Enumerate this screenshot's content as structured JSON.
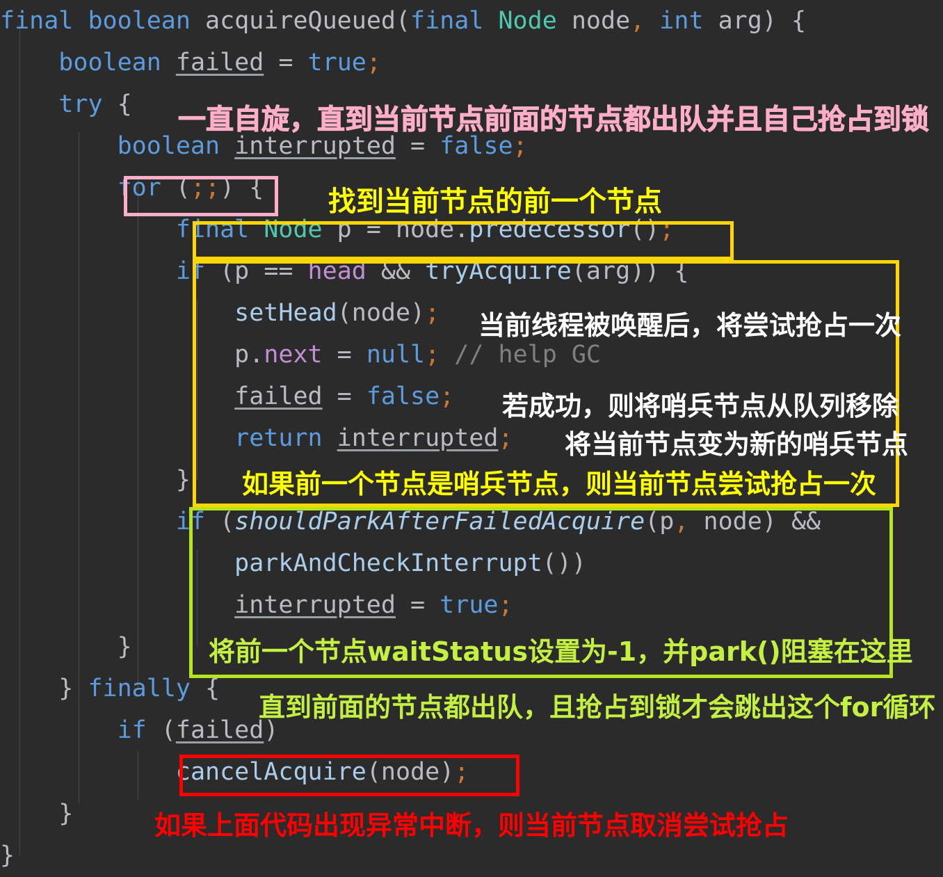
{
  "editor": {
    "theme": "dark",
    "background": "#2b2b2b",
    "language": "java",
    "method_name": "acquireQueued"
  },
  "colors": {
    "background": "#2b2b2b",
    "keyword": "#5c9cde",
    "type": "#4ec9b0",
    "plain": "#b9bcc2",
    "field": "#c08fd4",
    "function": "#a9cdeb",
    "semicolon": "#cc7832",
    "comment": "#808080",
    "box_pink": "#ffaec9",
    "box_yellow": "#ffd700",
    "box_green": "#b5e61d",
    "box_red": "#ff0000",
    "anno_yellow": "#ffff00",
    "anno_white": "#ffffff",
    "anno_green": "#c3f041",
    "anno_red": "#ff0000",
    "anno_pink": "#ffaec9"
  },
  "code_lines": [
    {
      "id": "line-signature",
      "indent": 0,
      "tokens": [
        {
          "t": "final",
          "c": "kw"
        },
        {
          "t": " ",
          "c": "pln"
        },
        {
          "t": "boolean",
          "c": "kw"
        },
        {
          "t": " ",
          "c": "pln"
        },
        {
          "t": "acquireQueued",
          "c": "pln"
        },
        {
          "t": "(",
          "c": "pln"
        },
        {
          "t": "final",
          "c": "kw"
        },
        {
          "t": " ",
          "c": "pln"
        },
        {
          "t": "Node",
          "c": "typ"
        },
        {
          "t": " node",
          "c": "pln"
        },
        {
          "t": ",",
          "c": "semi"
        },
        {
          "t": " ",
          "c": "pln"
        },
        {
          "t": "int",
          "c": "kw"
        },
        {
          "t": " arg",
          "c": "pln"
        },
        {
          "t": ") {",
          "c": "pln"
        }
      ]
    },
    {
      "id": "line-failed-true",
      "indent": 1,
      "tokens": [
        {
          "t": "boolean",
          "c": "kw"
        },
        {
          "t": " ",
          "c": "pln"
        },
        {
          "t": "failed",
          "c": "var-u"
        },
        {
          "t": " = ",
          "c": "pln"
        },
        {
          "t": "true",
          "c": "kw"
        },
        {
          "t": ";",
          "c": "semi"
        }
      ]
    },
    {
      "id": "line-try",
      "indent": 1,
      "tokens": [
        {
          "t": "try",
          "c": "kw"
        },
        {
          "t": " {",
          "c": "pln"
        }
      ]
    },
    {
      "id": "line-interrupted-false",
      "indent": 2,
      "tokens": [
        {
          "t": "boolean",
          "c": "kw"
        },
        {
          "t": " ",
          "c": "pln"
        },
        {
          "t": "interrupted",
          "c": "var-u"
        },
        {
          "t": " = ",
          "c": "pln"
        },
        {
          "t": "false",
          "c": "kw"
        },
        {
          "t": ";",
          "c": "semi"
        }
      ]
    },
    {
      "id": "line-for",
      "indent": 2,
      "tokens": [
        {
          "t": "for",
          "c": "kw"
        },
        {
          "t": " (",
          "c": "pln"
        },
        {
          "t": ";",
          "c": "semi"
        },
        {
          "t": ";",
          "c": "semi"
        },
        {
          "t": ") {",
          "c": "pln"
        }
      ]
    },
    {
      "id": "line-predecessor",
      "indent": 3,
      "tokens": [
        {
          "t": "final",
          "c": "kw"
        },
        {
          "t": " ",
          "c": "pln"
        },
        {
          "t": "Node",
          "c": "typ"
        },
        {
          "t": " p = node.",
          "c": "pln"
        },
        {
          "t": "predecessor",
          "c": "fn"
        },
        {
          "t": "()",
          "c": "pln"
        },
        {
          "t": ";",
          "c": "semi"
        }
      ]
    },
    {
      "id": "line-if-head",
      "indent": 3,
      "tokens": [
        {
          "t": "if",
          "c": "kw"
        },
        {
          "t": " (p == ",
          "c": "pln"
        },
        {
          "t": "head",
          "c": "fld"
        },
        {
          "t": " && ",
          "c": "pln"
        },
        {
          "t": "tryAcquire",
          "c": "fn"
        },
        {
          "t": "(arg)) {",
          "c": "pln"
        }
      ]
    },
    {
      "id": "line-sethead",
      "indent": 4,
      "tokens": [
        {
          "t": "setHead",
          "c": "fn"
        },
        {
          "t": "(node)",
          "c": "pln"
        },
        {
          "t": ";",
          "c": "semi"
        }
      ]
    },
    {
      "id": "line-pnext-null",
      "indent": 4,
      "tokens": [
        {
          "t": "p.",
          "c": "pln"
        },
        {
          "t": "next",
          "c": "fld"
        },
        {
          "t": " = ",
          "c": "pln"
        },
        {
          "t": "null",
          "c": "kw"
        },
        {
          "t": ";",
          "c": "semi"
        },
        {
          "t": " ",
          "c": "pln"
        },
        {
          "t": "// help GC",
          "c": "cmt"
        }
      ]
    },
    {
      "id": "line-failed-false",
      "indent": 4,
      "tokens": [
        {
          "t": "failed",
          "c": "var-u"
        },
        {
          "t": " = ",
          "c": "pln"
        },
        {
          "t": "false",
          "c": "kw"
        },
        {
          "t": ";",
          "c": "semi"
        }
      ]
    },
    {
      "id": "line-return-interrupted",
      "indent": 4,
      "tokens": [
        {
          "t": "return",
          "c": "kw"
        },
        {
          "t": " ",
          "c": "pln"
        },
        {
          "t": "interrupted",
          "c": "var-u"
        },
        {
          "t": ";",
          "c": "semi"
        }
      ]
    },
    {
      "id": "line-close-if-head",
      "indent": 3,
      "tokens": [
        {
          "t": "}",
          "c": "pln"
        }
      ]
    },
    {
      "id": "line-if-shouldpark",
      "indent": 3,
      "tokens": [
        {
          "t": "if",
          "c": "kw"
        },
        {
          "t": " (",
          "c": "pln"
        },
        {
          "t": "shouldParkAfterFailedAcquire",
          "c": "ital"
        },
        {
          "t": "(p",
          "c": "pln"
        },
        {
          "t": ",",
          "c": "semi"
        },
        {
          "t": " node) &&",
          "c": "pln"
        }
      ]
    },
    {
      "id": "line-parkcheck",
      "indent": 4,
      "tokens": [
        {
          "t": "parkAndCheckInterrupt",
          "c": "fn"
        },
        {
          "t": "())",
          "c": "pln"
        }
      ]
    },
    {
      "id": "line-interrupted-true",
      "indent": 4,
      "tokens": [
        {
          "t": "interrupted",
          "c": "var-u"
        },
        {
          "t": " = ",
          "c": "pln"
        },
        {
          "t": "true",
          "c": "kw"
        },
        {
          "t": ";",
          "c": "semi"
        }
      ]
    },
    {
      "id": "line-close-for",
      "indent": 2,
      "tokens": [
        {
          "t": "}",
          "c": "pln"
        }
      ]
    },
    {
      "id": "line-finally",
      "indent": 1,
      "tokens": [
        {
          "t": "}",
          "c": "pln"
        },
        {
          "t": " ",
          "c": "pln"
        },
        {
          "t": "finally",
          "c": "kw"
        },
        {
          "t": " {",
          "c": "pln"
        }
      ]
    },
    {
      "id": "line-if-failed",
      "indent": 2,
      "tokens": [
        {
          "t": "if",
          "c": "kw"
        },
        {
          "t": " (",
          "c": "pln"
        },
        {
          "t": "failed",
          "c": "var-u"
        },
        {
          "t": ")",
          "c": "pln"
        }
      ]
    },
    {
      "id": "line-cancelacquire",
      "indent": 3,
      "tokens": [
        {
          "t": "cancelAcquire",
          "c": "fn"
        },
        {
          "t": "(node)",
          "c": "pln"
        },
        {
          "t": ";",
          "c": "semi"
        }
      ]
    },
    {
      "id": "line-close-finally",
      "indent": 1,
      "tokens": [
        {
          "t": "}",
          "c": "pln"
        }
      ]
    },
    {
      "id": "line-close-method",
      "indent": 0,
      "tokens": [
        {
          "t": "}",
          "c": "pln"
        }
      ]
    }
  ],
  "annotations": {
    "spin_note": "一直自旋，直到当前节点前面的节点都出队并且自己抢占到锁",
    "find_predecessor": "找到当前节点的前一个节点",
    "thread_awake_try": "当前线程被唤醒后，将尝试抢占一次",
    "success_remove_head": "若成功，则将哨兵节点从队列移除",
    "become_new_head": "将当前节点变为新的哨兵节点",
    "prev_is_head_try": "如果前一个节点是哨兵节点，则当前节点尝试抢占一次",
    "set_waitstatus_park": "将前一个节点waitStatus设置为-1，并park()阻塞在这里",
    "break_for_loop": "直到前面的节点都出队，且抢占到锁才会跳出这个for循环",
    "exception_cancel": "如果上面代码出现异常中断，则当前节点取消尝试抢占"
  },
  "highlight_boxes": [
    {
      "name": "for-loop-box",
      "color": "#ffaec9",
      "target": "for (;;)"
    },
    {
      "name": "predecessor-box",
      "color": "#ffd700",
      "target": "final Node p = node.predecessor();"
    },
    {
      "name": "try-acquire-box",
      "color": "#ffd700",
      "target": "if (p == head && tryAcquire(arg)) { ... }"
    },
    {
      "name": "should-park-box",
      "color": "#b5e61d",
      "target": "if (shouldParkAfterFailedAcquire(p, node) && parkAndCheckInterrupt()) interrupted = true;"
    },
    {
      "name": "cancel-acquire-box",
      "color": "#ff0000",
      "target": "cancelAcquire(node);"
    }
  ]
}
